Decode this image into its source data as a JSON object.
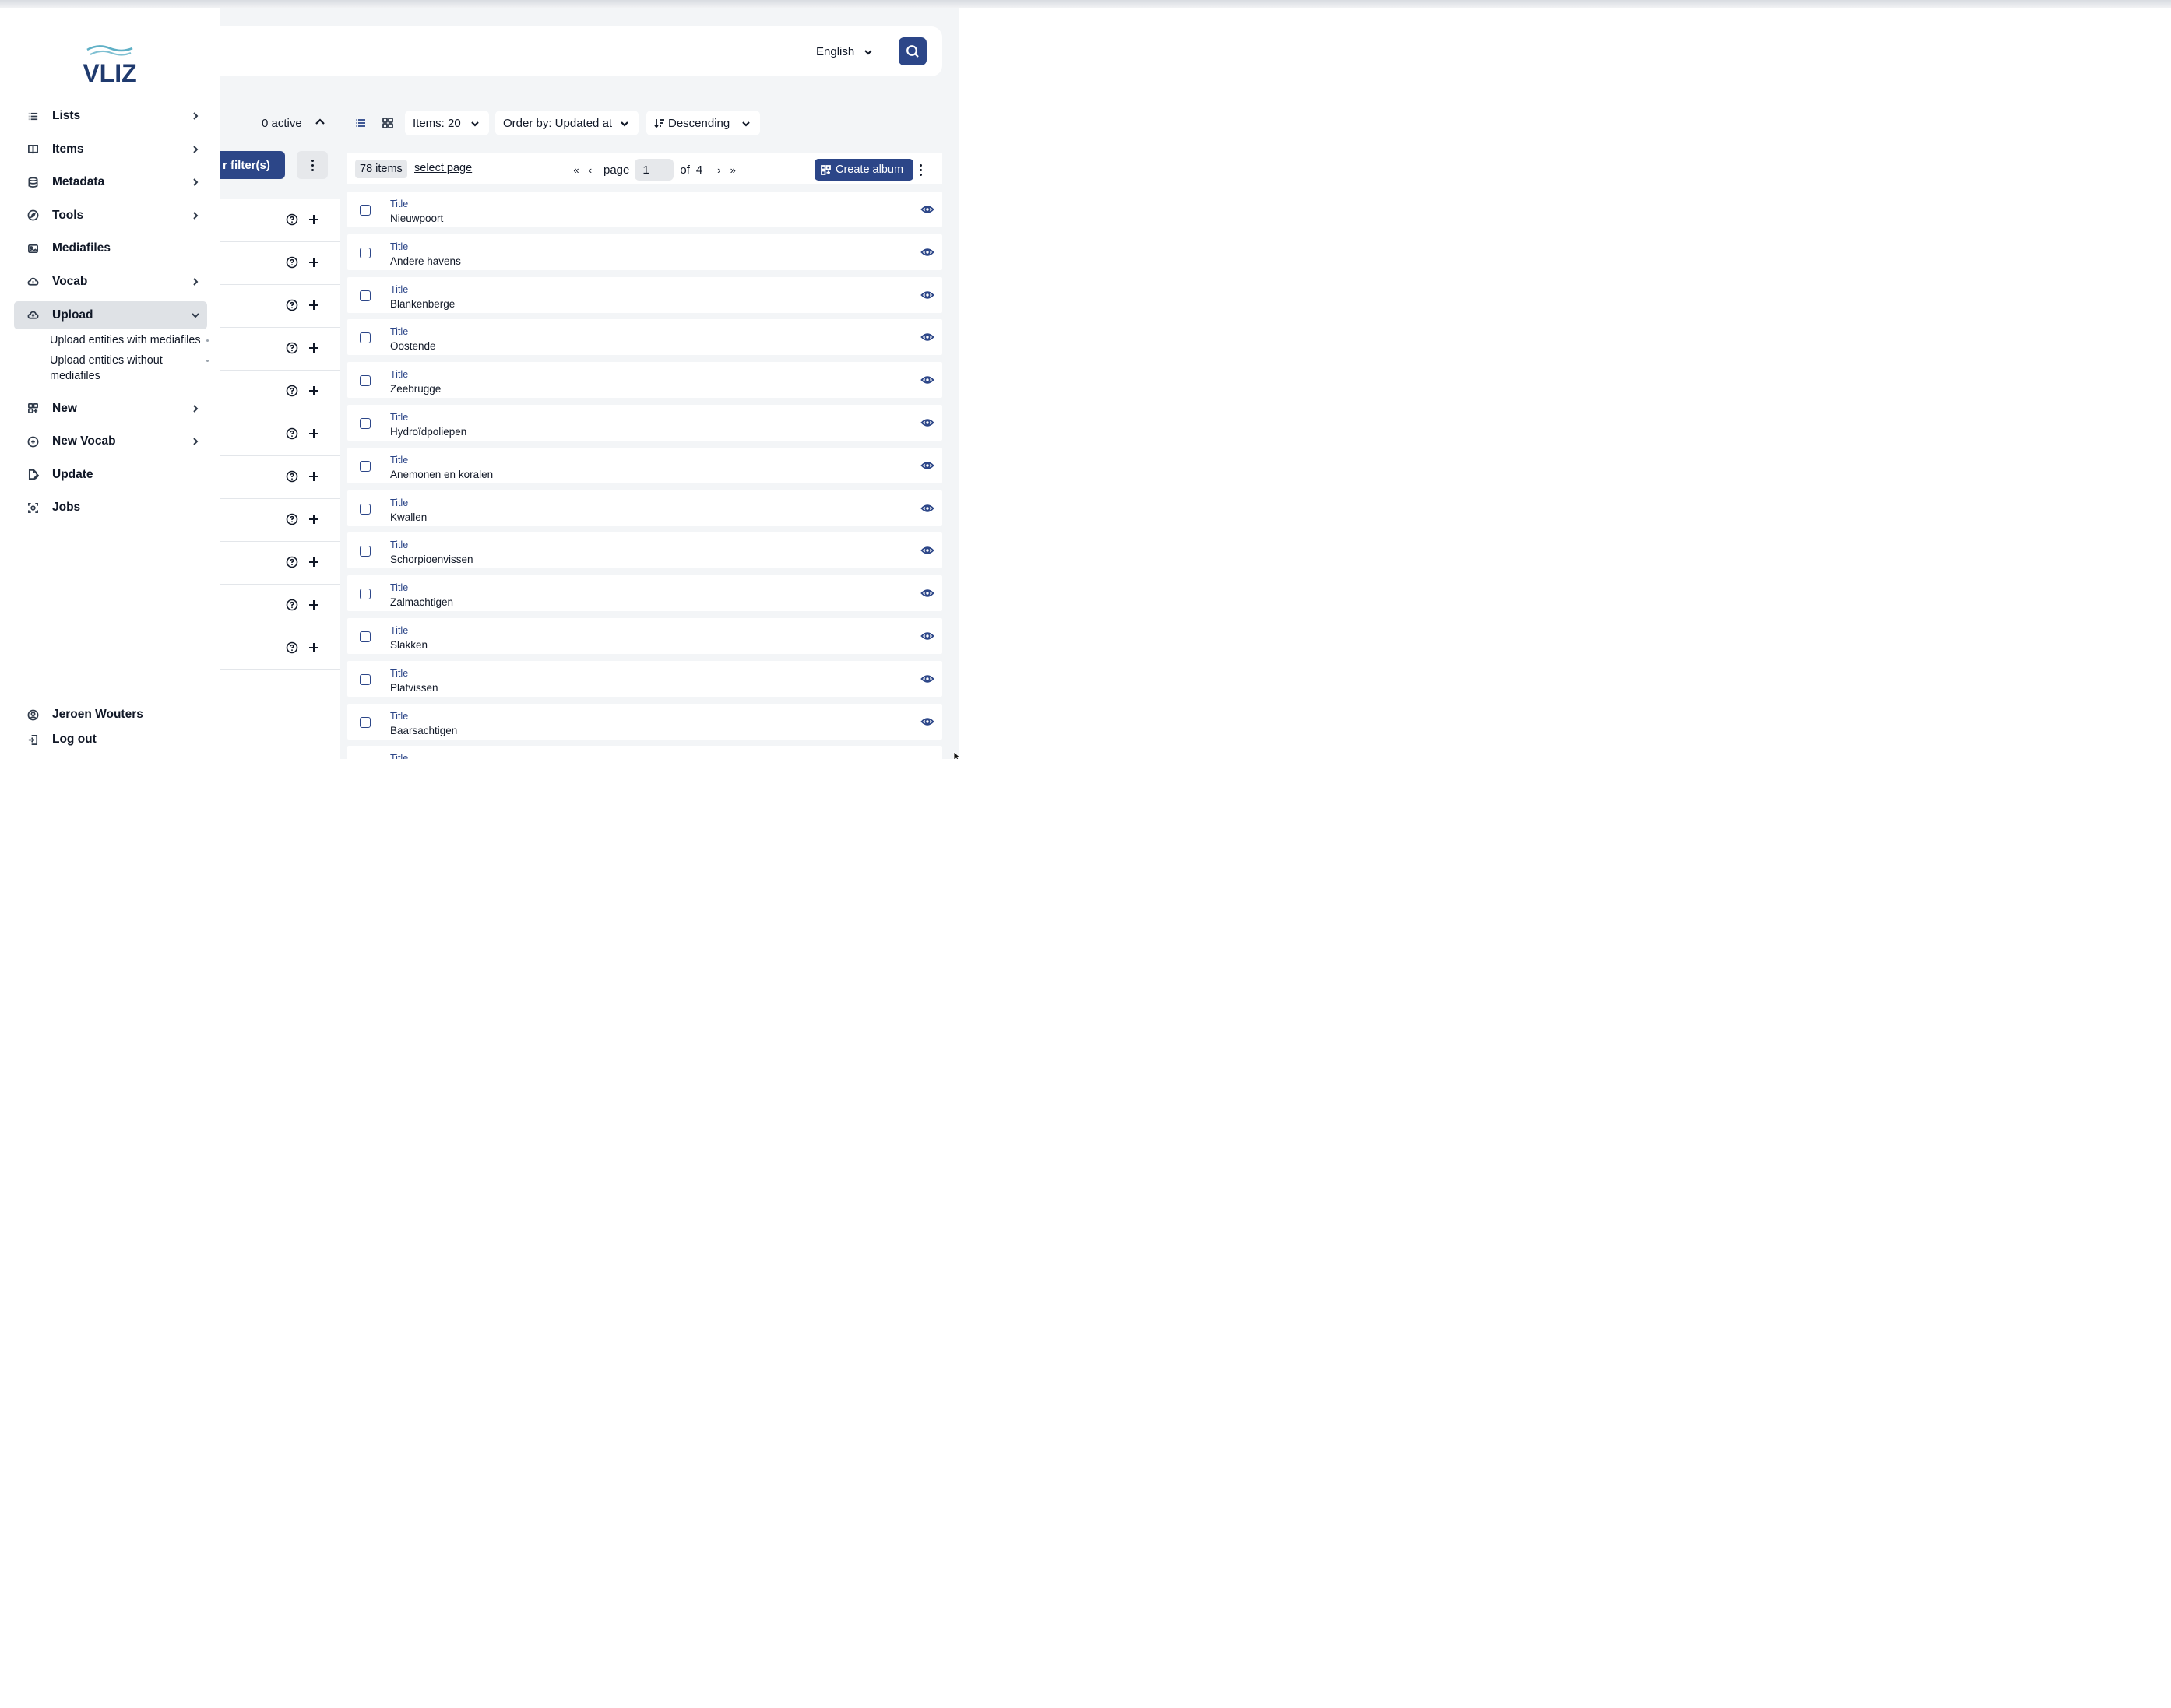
{
  "brand": {
    "logo_text": "VLIZ"
  },
  "sidebar": {
    "items": [
      {
        "label": "Lists",
        "icon": "list-icon",
        "has_chevron": true
      },
      {
        "label": "Items",
        "icon": "book-icon",
        "has_chevron": true
      },
      {
        "label": "Metadata",
        "icon": "database-icon",
        "has_chevron": true
      },
      {
        "label": "Tools",
        "icon": "compass-icon",
        "has_chevron": true
      },
      {
        "label": "Mediafiles",
        "icon": "image-icon",
        "has_chevron": false
      },
      {
        "label": "Vocab",
        "icon": "cloud-icon",
        "has_chevron": true
      },
      {
        "label": "Upload",
        "icon": "cloud-upload-icon",
        "has_chevron": true,
        "expanded": true
      },
      {
        "label": "New",
        "icon": "grid-plus-icon",
        "has_chevron": true
      },
      {
        "label": "New Vocab",
        "icon": "circle-plus-icon",
        "has_chevron": true
      },
      {
        "label": "Update",
        "icon": "file-edit-icon",
        "has_chevron": false
      },
      {
        "label": "Jobs",
        "icon": "jobs-icon",
        "has_chevron": false
      }
    ],
    "upload_subitems": [
      {
        "label": "Upload entities with mediafiles"
      },
      {
        "label": "Upload entities without mediafiles"
      }
    ],
    "account": {
      "user_name": "Jeroen Wouters",
      "logout_label": "Log out"
    }
  },
  "header": {
    "language": "English"
  },
  "filters": {
    "active_count": "0 active",
    "apply_label": "r filter(s)",
    "row_count": 11
  },
  "view": {
    "items_per_page": "Items: 20",
    "order_by": "Order by: Updated at",
    "direction": "Descending"
  },
  "results": {
    "count_label": "78 items",
    "select_page_label": "select page",
    "pager": {
      "first": "«",
      "prev": "‹",
      "page_label": "page",
      "current_page": "1",
      "of_label": "of",
      "total_pages": "4",
      "next": "›",
      "last": "»"
    },
    "create_album_label": "Create album",
    "field_label": "Title",
    "rows": [
      "Nieuwpoort",
      "Andere havens",
      "Blankenberge",
      "Oostende",
      "Zeebrugge",
      "Hydroïdpoliepen",
      "Anemonen en koralen",
      "Kwallen",
      "Schorpioenvissen",
      "Zalmachtigen",
      "Slakken",
      "Platvissen",
      "Baarsachtigen",
      ""
    ]
  },
  "colors": {
    "primary": "#2c4688",
    "background": "#f3f5f7",
    "active_nav": "#dfe2e6",
    "text": "#111827"
  }
}
